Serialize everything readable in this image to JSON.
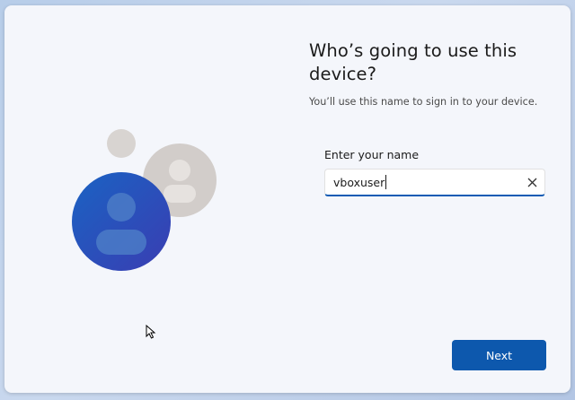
{
  "page": {
    "heading": "Who’s going to use this device?",
    "subtitle": "You’ll use this name to sign in to your device."
  },
  "name_field": {
    "label": "Enter your name",
    "value": "vboxuser"
  },
  "buttons": {
    "next_label": "Next"
  },
  "icons": {
    "illustration": "user-accounts-illustration",
    "clear": "close-icon",
    "pointer": "mouse-pointer-icon"
  },
  "colors": {
    "accent": "#0d58ad",
    "background": "#f4f6fb",
    "primary_avatar": "#2457b8"
  }
}
